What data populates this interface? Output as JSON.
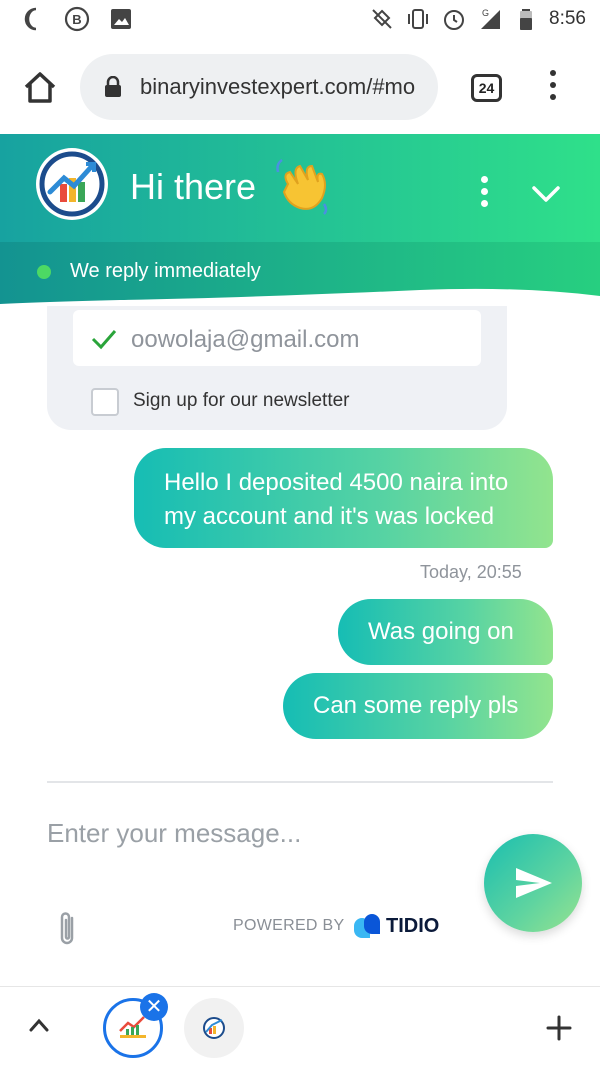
{
  "status_bar": {
    "time": "8:56",
    "left_icons": [
      "moon-icon",
      "b-circle-icon",
      "image-icon"
    ],
    "right_icons": [
      "alarm-off-icon",
      "vibrate-icon",
      "alarm-icon",
      "signal-icon",
      "battery-icon"
    ],
    "signal_label": "G"
  },
  "browser": {
    "url": "binaryinvestexpert.com/#mo",
    "tab_count": "24"
  },
  "chat_header": {
    "title": "Hi there",
    "status_text": "We reply immediately",
    "colors": {
      "gradient_start": "#17a2a0",
      "gradient_end": "#2fe08a",
      "online_dot": "#4cd964"
    }
  },
  "contact_card": {
    "email_value": "oowolaja@gmail.com",
    "newsletter_label": "Sign up for our newsletter",
    "newsletter_checked": false
  },
  "messages": [
    {
      "text": "Hello I deposited 4500 naira into my account and it's was locked"
    },
    {
      "text": "Was going on"
    },
    {
      "text": "Can some reply pls"
    }
  ],
  "message_time": "Today, 20:55",
  "composer": {
    "placeholder": "Enter your message...",
    "powered_by": "POWERED BY",
    "brand": "TIDIO"
  },
  "bottom_bar": {
    "tab_close_glyph": "✕",
    "accent": "#1a73e8"
  }
}
